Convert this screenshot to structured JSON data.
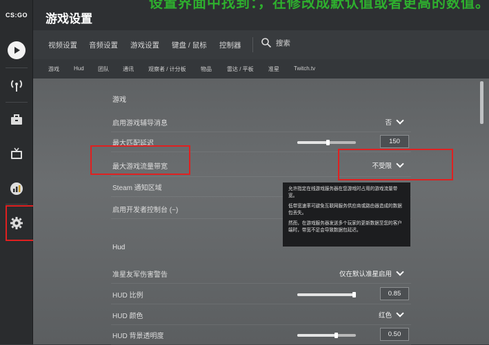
{
  "app": {
    "logo_text": "CS:GO",
    "page_title": "游戏设置",
    "overlay_caption": "设置界面中找到：，在修改成默认值或者更高的数值。"
  },
  "sidebar": {
    "items": [
      {
        "name": "play",
        "icon": "play-icon"
      },
      {
        "name": "broadcast",
        "icon": "antenna-icon"
      },
      {
        "name": "inventory",
        "icon": "briefcase-icon"
      },
      {
        "name": "watch",
        "icon": "tv-icon"
      },
      {
        "name": "stats",
        "icon": "chart-badge-icon"
      },
      {
        "name": "settings",
        "icon": "gear-icon"
      }
    ]
  },
  "tabs": [
    "视频设置",
    "音频设置",
    "游戏设置",
    "键盘 / 鼠标",
    "控制器"
  ],
  "search": {
    "label": "搜索"
  },
  "subtabs": [
    "游戏",
    "Hud",
    "团队",
    "通讯",
    "观察者 / 计分板",
    "物品",
    "雷达 / 平板",
    "准星",
    "Twitch.tv"
  ],
  "sections": {
    "game": {
      "title": "游戏",
      "rows": [
        {
          "label": "启用游戏辅导消息",
          "value": "否"
        },
        {
          "label": "最大匹配延迟",
          "value": "150",
          "slider": 0.52
        },
        {
          "label": "最大游戏流量带宽",
          "value": "不受限"
        },
        {
          "label": "Steam 通知区域",
          "value": ""
        },
        {
          "label": "启用开发者控制台 (~)",
          "value": ""
        }
      ]
    },
    "hud": {
      "title": "Hud",
      "rows": [
        {
          "label": "准星友军伤害警告",
          "value": "仅在默认准星启用"
        },
        {
          "label": "HUD 比例",
          "value": "0.85",
          "slider": 0.96
        },
        {
          "label": "HUD 颜色",
          "value": "红色"
        },
        {
          "label": "HUD 背景透明度",
          "value": "0.50",
          "slider": 0.66
        }
      ]
    }
  },
  "tooltip": {
    "p1": "允许指定在线游戏服务器在您游戏时占用的游戏流量带宽。",
    "p2": "低带宽速率可避免互联网服务供应商或路由器造成的数据包丢失。",
    "p3": "然而，在游戏服务器发送多个玩家的更新数据至您的客户端时，带宽不足会导致数据包延迟。"
  },
  "colors": {
    "highlight": "#e02020",
    "overlay_text": "#2ebd2e"
  }
}
